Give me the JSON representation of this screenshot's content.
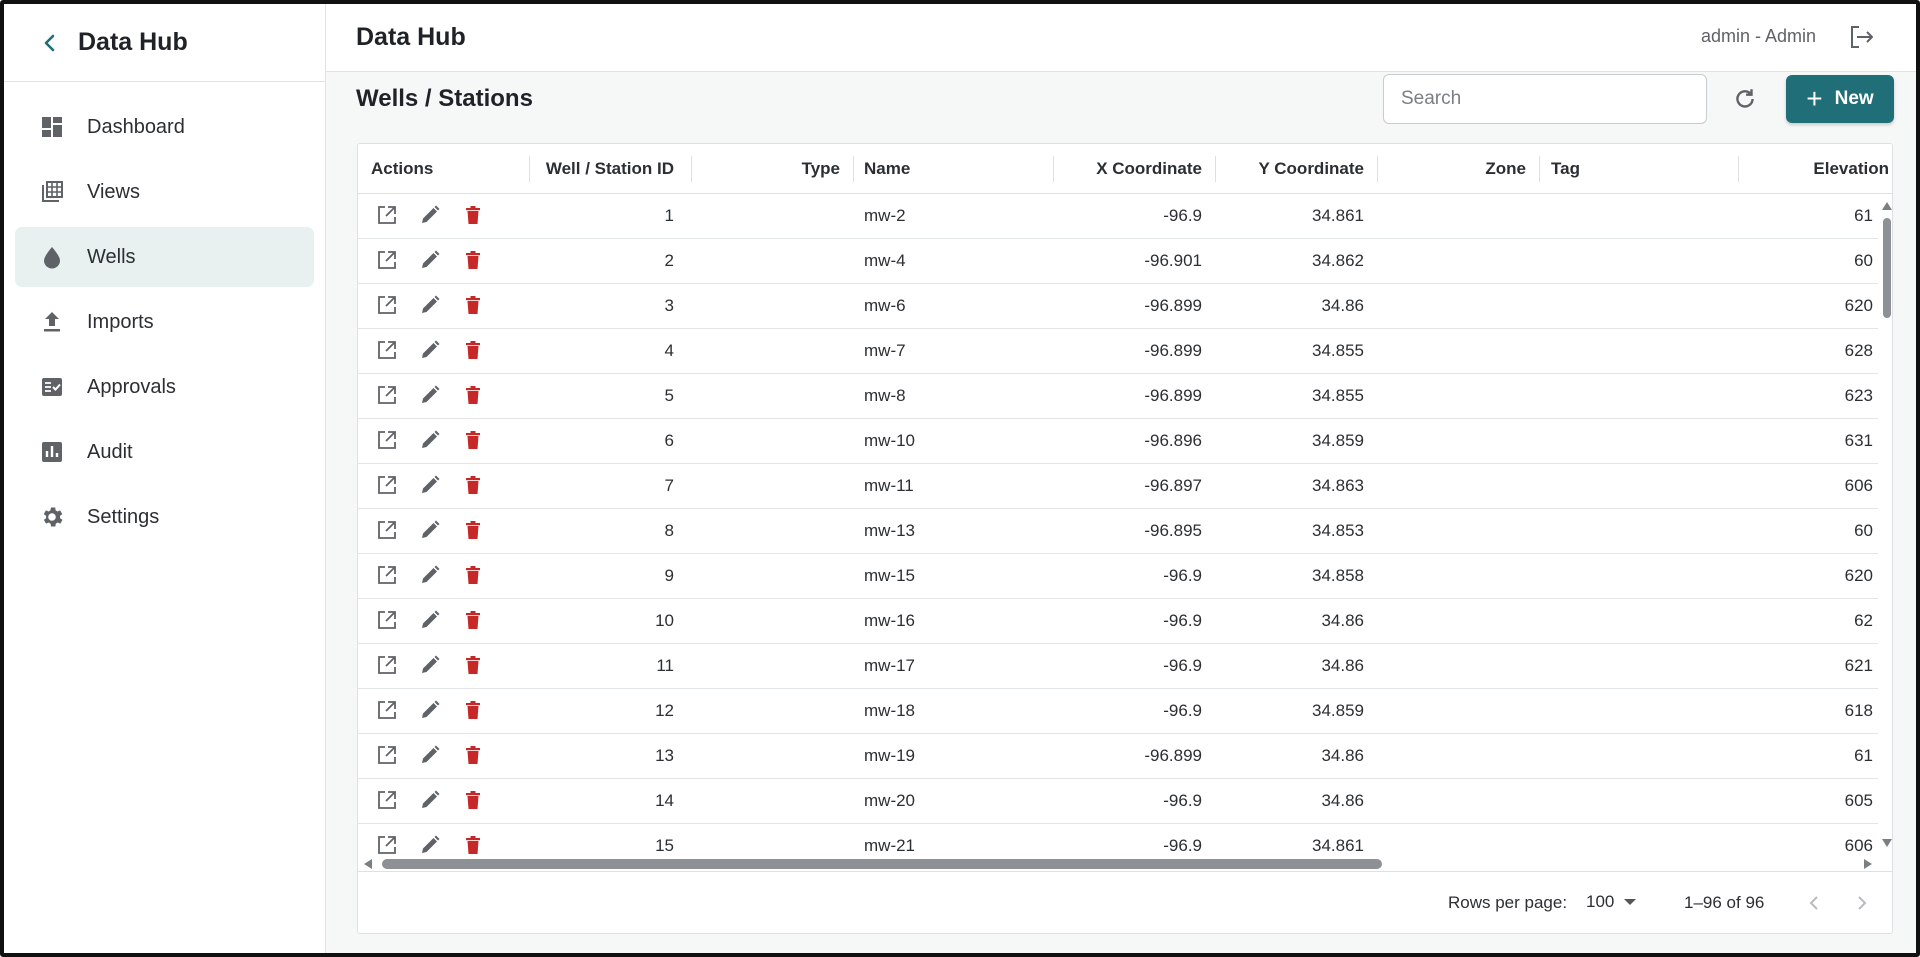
{
  "sidebar": {
    "title": "Data Hub",
    "items": [
      {
        "label": "Dashboard",
        "icon": "dashboard-icon"
      },
      {
        "label": "Views",
        "icon": "views-icon"
      },
      {
        "label": "Wells",
        "icon": "droplet-icon",
        "active": true
      },
      {
        "label": "Imports",
        "icon": "upload-icon"
      },
      {
        "label": "Approvals",
        "icon": "approvals-icon"
      },
      {
        "label": "Audit",
        "icon": "chart-icon"
      },
      {
        "label": "Settings",
        "icon": "gear-icon"
      }
    ]
  },
  "header": {
    "title": "Data Hub",
    "user": "admin - Admin"
  },
  "page": {
    "title": "Wells / Stations",
    "search_placeholder": "Search",
    "new_label": "New"
  },
  "colors": {
    "accent": "#206e78",
    "active_nav": "#e8f0f0",
    "delete": "#c62828",
    "icon": "#5f6367"
  },
  "table": {
    "columns": [
      "Actions",
      "Well / Station ID",
      "Type",
      "Name",
      "X Coordinate",
      "Y Coordinate",
      "Zone",
      "Tag",
      "Elevation"
    ],
    "rows": [
      {
        "id": "1",
        "type": "",
        "name": "mw-2",
        "x": "-96.9",
        "y": "34.861",
        "zone": "",
        "tag": "",
        "elev": "61"
      },
      {
        "id": "2",
        "type": "",
        "name": "mw-4",
        "x": "-96.901",
        "y": "34.862",
        "zone": "",
        "tag": "",
        "elev": "60"
      },
      {
        "id": "3",
        "type": "",
        "name": "mw-6",
        "x": "-96.899",
        "y": "34.86",
        "zone": "",
        "tag": "",
        "elev": "620"
      },
      {
        "id": "4",
        "type": "",
        "name": "mw-7",
        "x": "-96.899",
        "y": "34.855",
        "zone": "",
        "tag": "",
        "elev": "628"
      },
      {
        "id": "5",
        "type": "",
        "name": "mw-8",
        "x": "-96.899",
        "y": "34.855",
        "zone": "",
        "tag": "",
        "elev": "623"
      },
      {
        "id": "6",
        "type": "",
        "name": "mw-10",
        "x": "-96.896",
        "y": "34.859",
        "zone": "",
        "tag": "",
        "elev": "631"
      },
      {
        "id": "7",
        "type": "",
        "name": "mw-11",
        "x": "-96.897",
        "y": "34.863",
        "zone": "",
        "tag": "",
        "elev": "606"
      },
      {
        "id": "8",
        "type": "",
        "name": "mw-13",
        "x": "-96.895",
        "y": "34.853",
        "zone": "",
        "tag": "",
        "elev": "60"
      },
      {
        "id": "9",
        "type": "",
        "name": "mw-15",
        "x": "-96.9",
        "y": "34.858",
        "zone": "",
        "tag": "",
        "elev": "620"
      },
      {
        "id": "10",
        "type": "",
        "name": "mw-16",
        "x": "-96.9",
        "y": "34.86",
        "zone": "",
        "tag": "",
        "elev": "62"
      },
      {
        "id": "11",
        "type": "",
        "name": "mw-17",
        "x": "-96.9",
        "y": "34.86",
        "zone": "",
        "tag": "",
        "elev": "621"
      },
      {
        "id": "12",
        "type": "",
        "name": "mw-18",
        "x": "-96.9",
        "y": "34.859",
        "zone": "",
        "tag": "",
        "elev": "618"
      },
      {
        "id": "13",
        "type": "",
        "name": "mw-19",
        "x": "-96.899",
        "y": "34.86",
        "zone": "",
        "tag": "",
        "elev": "61"
      },
      {
        "id": "14",
        "type": "",
        "name": "mw-20",
        "x": "-96.9",
        "y": "34.86",
        "zone": "",
        "tag": "",
        "elev": "605"
      },
      {
        "id": "15",
        "type": "",
        "name": "mw-21",
        "x": "-96.9",
        "y": "34.861",
        "zone": "",
        "tag": "",
        "elev": "606"
      }
    ]
  },
  "footer": {
    "rows_per_page_label": "Rows per page:",
    "rows_per_page": "100",
    "range": "1–96 of 96"
  }
}
